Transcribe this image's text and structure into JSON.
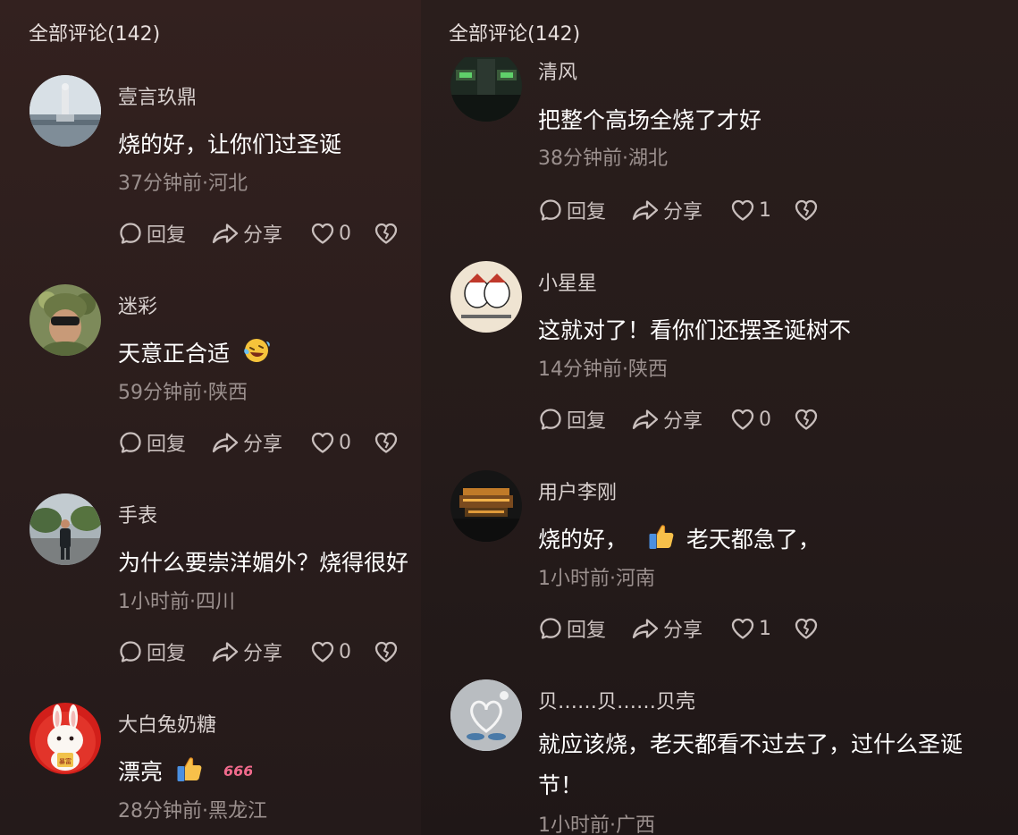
{
  "left_panel": {
    "header": "全部评论(142)",
    "comments": [
      {
        "username": "壹言玖鼎",
        "text": "烧的好，让你们过圣诞",
        "meta": "37分钟前·河北",
        "reply_label": "回复",
        "share_label": "分享",
        "likes": "0"
      },
      {
        "username": "迷彩",
        "text": "天意正合适",
        "meta": "59分钟前·陕西",
        "reply_label": "回复",
        "share_label": "分享",
        "likes": "0"
      },
      {
        "username": "手表",
        "text": "为什么要崇洋媚外？烧得很好",
        "meta": "1小时前·四川",
        "reply_label": "回复",
        "share_label": "分享",
        "likes": "0"
      },
      {
        "username": "大白兔奶糖",
        "text": "漂亮",
        "meta": "28分钟前·黑龙江"
      }
    ]
  },
  "right_panel": {
    "header": "全部评论(142)",
    "comments": [
      {
        "username": "清风",
        "text": "把整个高场全烧了才好",
        "meta": "38分钟前·湖北",
        "reply_label": "回复",
        "share_label": "分享",
        "likes": "1"
      },
      {
        "username": "小星星",
        "text": "这就对了！看你们还摆圣诞树不",
        "meta": "14分钟前·陕西",
        "reply_label": "回复",
        "share_label": "分享",
        "likes": "0"
      },
      {
        "username": "用户李刚",
        "text_before": "烧的好，",
        "text_after": "老天都急了，",
        "meta": "1小时前·河南",
        "reply_label": "回复",
        "share_label": "分享",
        "likes": "1"
      },
      {
        "username": "贝……贝……贝壳",
        "text": "就应该烧，老天都看不过去了，过什么圣诞节！",
        "meta": "1小时前·广西"
      }
    ]
  },
  "avatar_badge_text": "暴富",
  "sticker_text": "666",
  "colors": {
    "left_bg": "#33211f",
    "right_bg": "#2a1e1c",
    "text_primary": "#ffffff",
    "text_secondary": "#9b908e",
    "action": "#c9bfbd"
  }
}
